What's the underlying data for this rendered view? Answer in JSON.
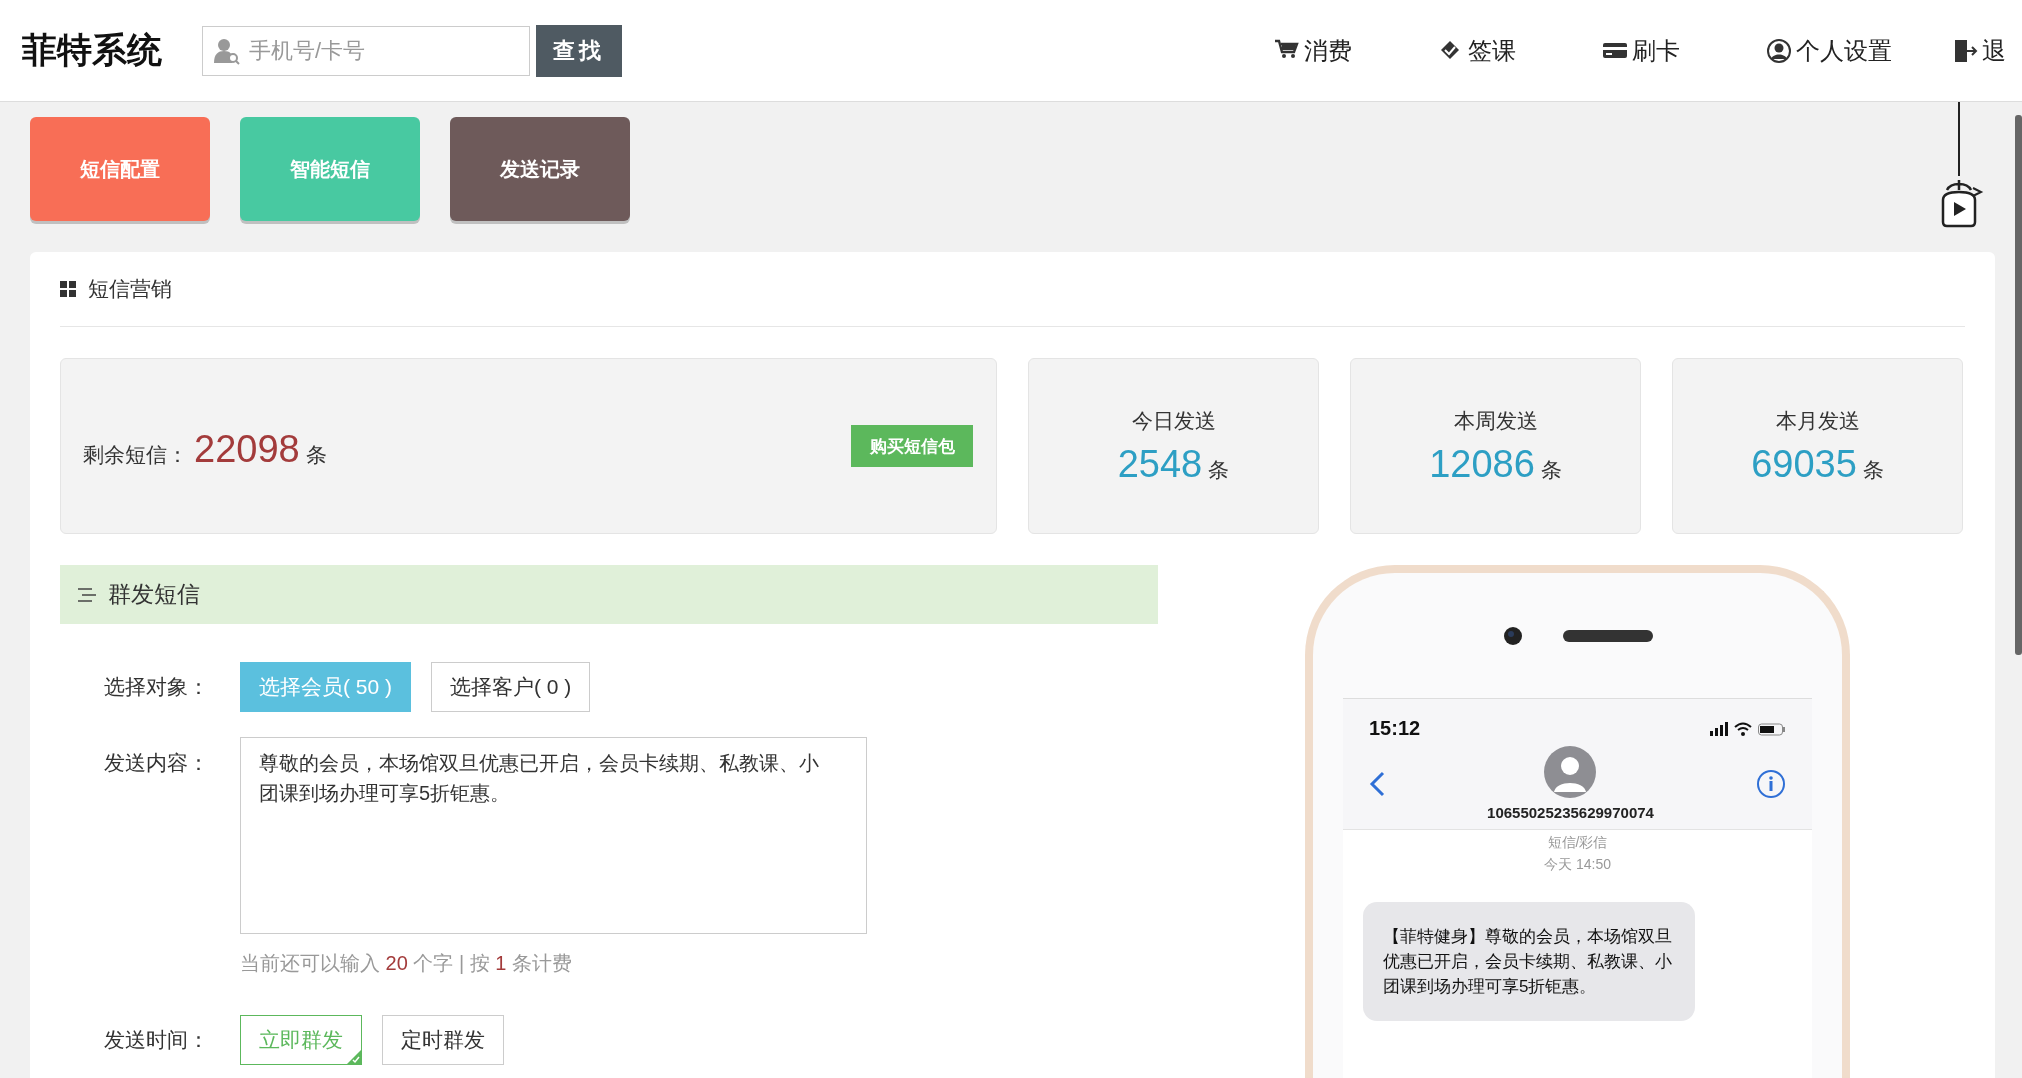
{
  "app": {
    "title": "菲特系统"
  },
  "search": {
    "placeholder": "手机号/卡号",
    "button": "查找"
  },
  "nav": [
    {
      "label": "消费",
      "kind": "cart"
    },
    {
      "label": "签课",
      "kind": "tag"
    },
    {
      "label": "刷卡",
      "kind": "card"
    },
    {
      "label": "个人设置",
      "kind": "user"
    },
    {
      "label": "退",
      "kind": "exit"
    }
  ],
  "tiles": [
    {
      "label": "短信配置",
      "color": "#f86e56"
    },
    {
      "label": "智能短信",
      "color": "#48c9a1"
    },
    {
      "label": "发送记录",
      "color": "#6e5a5a"
    }
  ],
  "panel": {
    "title": "短信营销"
  },
  "balance": {
    "label": "剩余短信：",
    "value": "22098",
    "unit": "条",
    "button": "购买短信包"
  },
  "stats": [
    {
      "label": "今日发送",
      "value": "2548",
      "unit": "条"
    },
    {
      "label": "本周发送",
      "value": "12086",
      "unit": "条"
    },
    {
      "label": "本月发送",
      "value": "69035",
      "unit": "条"
    }
  ],
  "section": {
    "title": "群发短信"
  },
  "target": {
    "label": "选择对象：",
    "options": [
      {
        "label": "选择会员( 50 )",
        "selected": true
      },
      {
        "label": "选择客户( 0 )",
        "selected": false
      }
    ]
  },
  "content": {
    "label": "发送内容：",
    "value": "尊敬的会员，本场馆双旦优惠已开启，会员卡续期、私教课、小团课到场办理可享5折钜惠。"
  },
  "hint": {
    "before": "当前还可以输入",
    "remaining": "20",
    "middle": "个字 | 按",
    "count": "1",
    "after": "条计费"
  },
  "schedule": {
    "label": "发送时间：",
    "options": [
      {
        "label": "立即群发",
        "selected": true
      },
      {
        "label": "定时群发",
        "selected": false
      }
    ]
  },
  "phone": {
    "time": "15:12",
    "sender": "10655025235629970074",
    "channel": "短信/彩信",
    "date": "今天 14:50",
    "message": "【菲特健身】尊敬的会员，本场馆双旦优惠已开启，会员卡续期、私教课、小团课到场办理可享5折钜惠。"
  }
}
